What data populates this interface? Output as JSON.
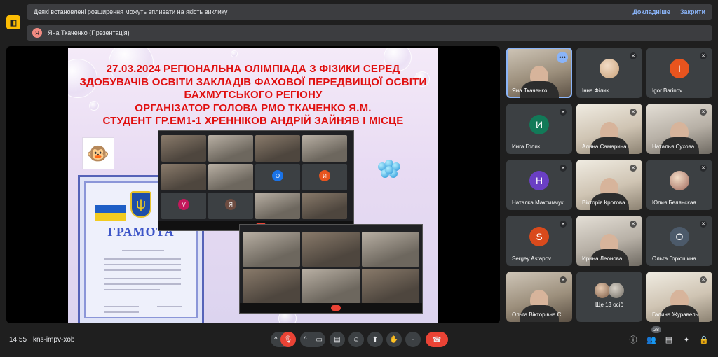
{
  "app": {
    "icon": "meet-app-icon"
  },
  "warning": {
    "text": "Деякі встановлені розширення можуть впливати на якість виклику",
    "details": "Докладніше",
    "close": "Закрити"
  },
  "presenter": {
    "initial": "Я",
    "label": "Яна Ткаченко (Презентація)"
  },
  "slide": {
    "title_lines": [
      "27.03.2024 РЕГІОНАЛЬНА ОЛІМПІАДА З ФІЗИКИ СЕРЕД",
      "ЗДОБУВАЧІВ ОСВІТИ ЗАКЛАДІВ ФАХОВОЇ ПЕРЕДВИЩОЇ ОСВІТИ",
      "БАХМУТСЬКОГО РЕГІОНУ",
      "ОРГАНІЗАТОР ГОЛОВА РМО ТКАЧЕНКО Я.М.",
      "СТУДЕНТ ГР.ЕМ1-1 ХРЕННІКОВ АНДРІЙ ЗАЙНЯВ І МІСЦЕ"
    ],
    "certificate_title": "ГРАМОТА",
    "shot1_initials": [
      "O",
      "И",
      "V",
      "Я"
    ]
  },
  "participants": [
    {
      "name": "Яна Ткаченко",
      "type": "photo",
      "style": "photo",
      "active": true
    },
    {
      "name": "Інна Філик",
      "type": "avatar-photo",
      "color": "#c9a27a"
    },
    {
      "name": "Igor Barinov",
      "type": "letter",
      "letter": "I",
      "color": "#e8541e"
    },
    {
      "name": "Инга Голик",
      "type": "letter",
      "letter": "И",
      "color": "#127a58"
    },
    {
      "name": "Алина Самарина",
      "type": "photo",
      "style": "photo2"
    },
    {
      "name": "Наталья Сухова",
      "type": "photo",
      "style": "photo3"
    },
    {
      "name": "Наталка Максимчук",
      "type": "letter",
      "letter": "Н",
      "color": "#6a3fc4"
    },
    {
      "name": "Вікторія Кротова",
      "type": "photo",
      "style": "photo2"
    },
    {
      "name": "Юлия Белянская",
      "type": "avatar-photo",
      "color": "#a0685c"
    },
    {
      "name": "Sergey Astapov",
      "type": "letter",
      "letter": "S",
      "color": "#d94a1c"
    },
    {
      "name": "Ирина Леонова",
      "type": "photo",
      "style": "photo3"
    },
    {
      "name": "Ольга Горюшина",
      "type": "letter",
      "letter": "О",
      "color": "#4c5a6a"
    },
    {
      "name": "Ольга Вікторівна С...",
      "type": "photo",
      "style": "photo"
    },
    {
      "name": "Ще 13 осіб",
      "type": "more"
    },
    {
      "name": "Галина Журавель",
      "type": "photo",
      "style": "photo2"
    }
  ],
  "bottom": {
    "time": "14:55",
    "meeting_code": "kns-impv-xob",
    "participants_count": "28"
  }
}
